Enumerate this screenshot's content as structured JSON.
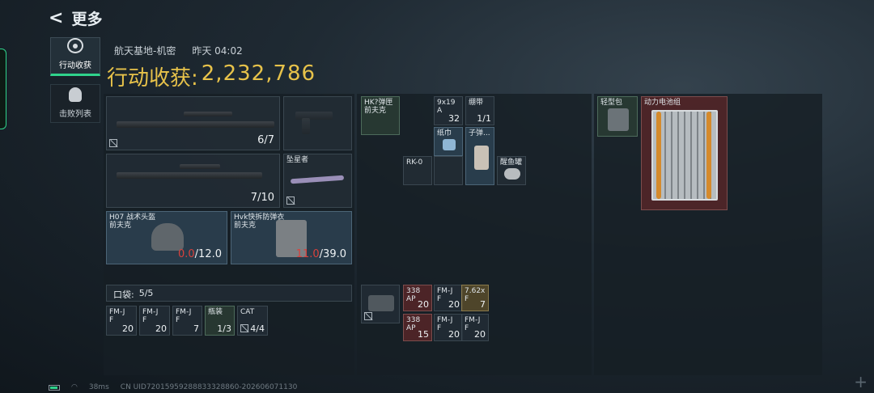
{
  "header": {
    "back_label": "更多"
  },
  "sidebar": {
    "tab_active": "行动收获",
    "tab_other": "击败列表"
  },
  "meta": {
    "map": "航天基地-机密",
    "time": "昨天 04:02"
  },
  "loot": {
    "label": "行动收获:",
    "value": "2,232,786"
  },
  "equipment": {
    "rifle1": {
      "ammo": "6/7"
    },
    "rifle2": {
      "ammo": "7/10"
    },
    "melee": {
      "name": "坠星者"
    },
    "helmet": {
      "name": "H07 战术头盔",
      "maker": "前夫克",
      "cur": "0.0",
      "max": "/12.0"
    },
    "armor": {
      "name": "Hvk快拆防弹衣",
      "maker": "前夫克",
      "cur": "11.0",
      "max": "/39.0"
    }
  },
  "pocket": {
    "label": "口袋:",
    "count": "5/5"
  },
  "pocket_items": [
    {
      "l1": "FM-J",
      "l2": "F",
      "n": "20"
    },
    {
      "l1": "FM-J",
      "l2": "F",
      "n": "20"
    },
    {
      "l1": "FM-J",
      "l2": "F",
      "n": "7"
    },
    {
      "l1": "瓶装",
      "l2": "",
      "n": "1/3"
    },
    {
      "l1": "CAT",
      "l2": "",
      "n": "4/4"
    }
  ],
  "chest": {
    "i1": {
      "l1": "HK?弹匣",
      "l2": "前夫克"
    },
    "i2": {
      "l1": "9x19",
      "l2": "A",
      "n": "32"
    },
    "i3": {
      "l1": "绷带",
      "n": "1/1"
    },
    "i4": {
      "l1": "纸巾"
    },
    "i5": {
      "l1": "RK-0"
    },
    "i6": {
      "l1": "子弹..."
    },
    "i7": {
      "l1": "醒鱼罐"
    }
  },
  "bag_items": [
    {
      "l1": "338",
      "l2": "AP",
      "n": "20"
    },
    {
      "l1": "FM-J",
      "l2": "F",
      "n": "20"
    },
    {
      "l1": "7.62x",
      "l2": "F",
      "n": "7"
    },
    {
      "l1": "338",
      "l2": "AP",
      "n": "15"
    },
    {
      "l1": "FM-J",
      "l2": "F",
      "n": "20"
    },
    {
      "l1": "FM-J",
      "l2": "F",
      "n": "20"
    }
  ],
  "backpack": {
    "name": "轻型包",
    "big_item": "动力电池组"
  },
  "status": {
    "ping": "38ms",
    "uid": "CN UID72015959288833328860-202606071130"
  },
  "colors": {
    "accent": "#e7c24a",
    "green": "#2fd38c",
    "damage": "#d9413c"
  }
}
